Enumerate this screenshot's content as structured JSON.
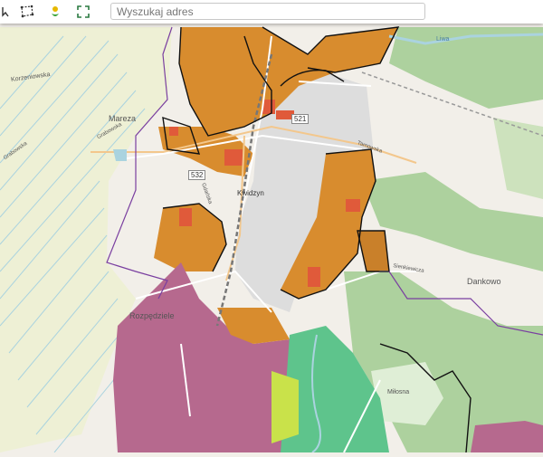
{
  "toolbar": {
    "search": {
      "placeholder": "Wyszukaj adres",
      "value": ""
    },
    "tools": [
      {
        "name": "select-tool-icon"
      },
      {
        "name": "polygon-select-icon"
      },
      {
        "name": "locate-icon"
      },
      {
        "name": "fullscreen-icon"
      }
    ]
  },
  "map": {
    "places": {
      "mareza": "Mareza",
      "kwidzyn": "Kwidzyn",
      "rozpedziele": "Rozpędziele",
      "dankowo": "Dankowo",
      "milosna": "Miłosna",
      "liwa": "Liwa"
    },
    "roads": {
      "r532": "532",
      "r521": "521",
      "kozienowska": "Korzeniowska",
      "grabowska": "Grabowska",
      "grabowska2": "Grabowska",
      "gdanska": "Gdańska",
      "tarnowska": "Tarnowska",
      "sienkiewicza": "Sienkiewicza"
    },
    "colors": {
      "residential": "#d88c2e",
      "industrial": "#b6698e",
      "forest": "#add19e",
      "water": "#aad3df",
      "boundary": "#7a3fa0"
    }
  }
}
